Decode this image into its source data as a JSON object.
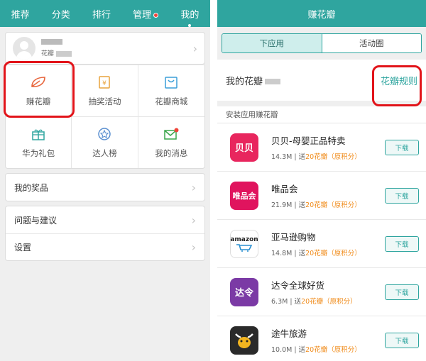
{
  "left": {
    "tabs": [
      {
        "label": "推荐"
      },
      {
        "label": "分类"
      },
      {
        "label": "排行"
      },
      {
        "label": "管理"
      },
      {
        "label": "我的"
      }
    ],
    "profile": {
      "subtitle": "花瓣"
    },
    "grid": [
      {
        "label": "赚花瓣",
        "icon": "petal-icon"
      },
      {
        "label": "抽奖活动",
        "icon": "lottery-icon"
      },
      {
        "label": "花瓣商城",
        "icon": "shopping-bag-icon"
      },
      {
        "label": "华为礼包",
        "icon": "gift-icon"
      },
      {
        "label": "达人榜",
        "icon": "medal-icon"
      },
      {
        "label": "我的消息",
        "icon": "envelope-icon"
      }
    ],
    "prizes_label": "我的奖品",
    "settings_list": [
      {
        "label": "问题与建议"
      },
      {
        "label": "设置"
      }
    ]
  },
  "right": {
    "title": "赚花瓣",
    "segments": [
      {
        "label": "下应用"
      },
      {
        "label": "活动圈"
      }
    ],
    "my_petals_label": "我的花瓣",
    "rules_link": "花瓣规则",
    "section_header": "安装应用赚花瓣",
    "download_label": "下载",
    "apps": [
      {
        "name": "贝贝-母婴正品特卖",
        "size": "14.3M",
        "sep": " | 送",
        "reward": "20花瓣（原积分）",
        "icon_text": "贝贝",
        "color": "#e8265e"
      },
      {
        "name": "唯品会",
        "size": "21.9M",
        "sep": " | 送",
        "reward": "20花瓣（原积分）",
        "icon_text": "唯品会",
        "color": "#e0145e"
      },
      {
        "name": "亚马逊购物",
        "size": "14.8M",
        "sep": " | 送",
        "reward": "20花瓣（原积分）",
        "icon_text": "amazon",
        "color": "#ffffff"
      },
      {
        "name": "达令全球好货",
        "size": "6.3M",
        "sep": " | 送",
        "reward": "20花瓣（原积分）",
        "icon_text": "达令",
        "color": "#7b3aa5"
      },
      {
        "name": "途牛旅游",
        "size": "10.0M",
        "sep": " | 送",
        "reward": "20花瓣（原积分）",
        "icon_text": "",
        "color": "#2a2a2a"
      }
    ]
  },
  "colors": {
    "accent": "#2fa59f",
    "highlight": "#e2141a",
    "reward": "#f08b1a",
    "badge": "#f0443a"
  }
}
